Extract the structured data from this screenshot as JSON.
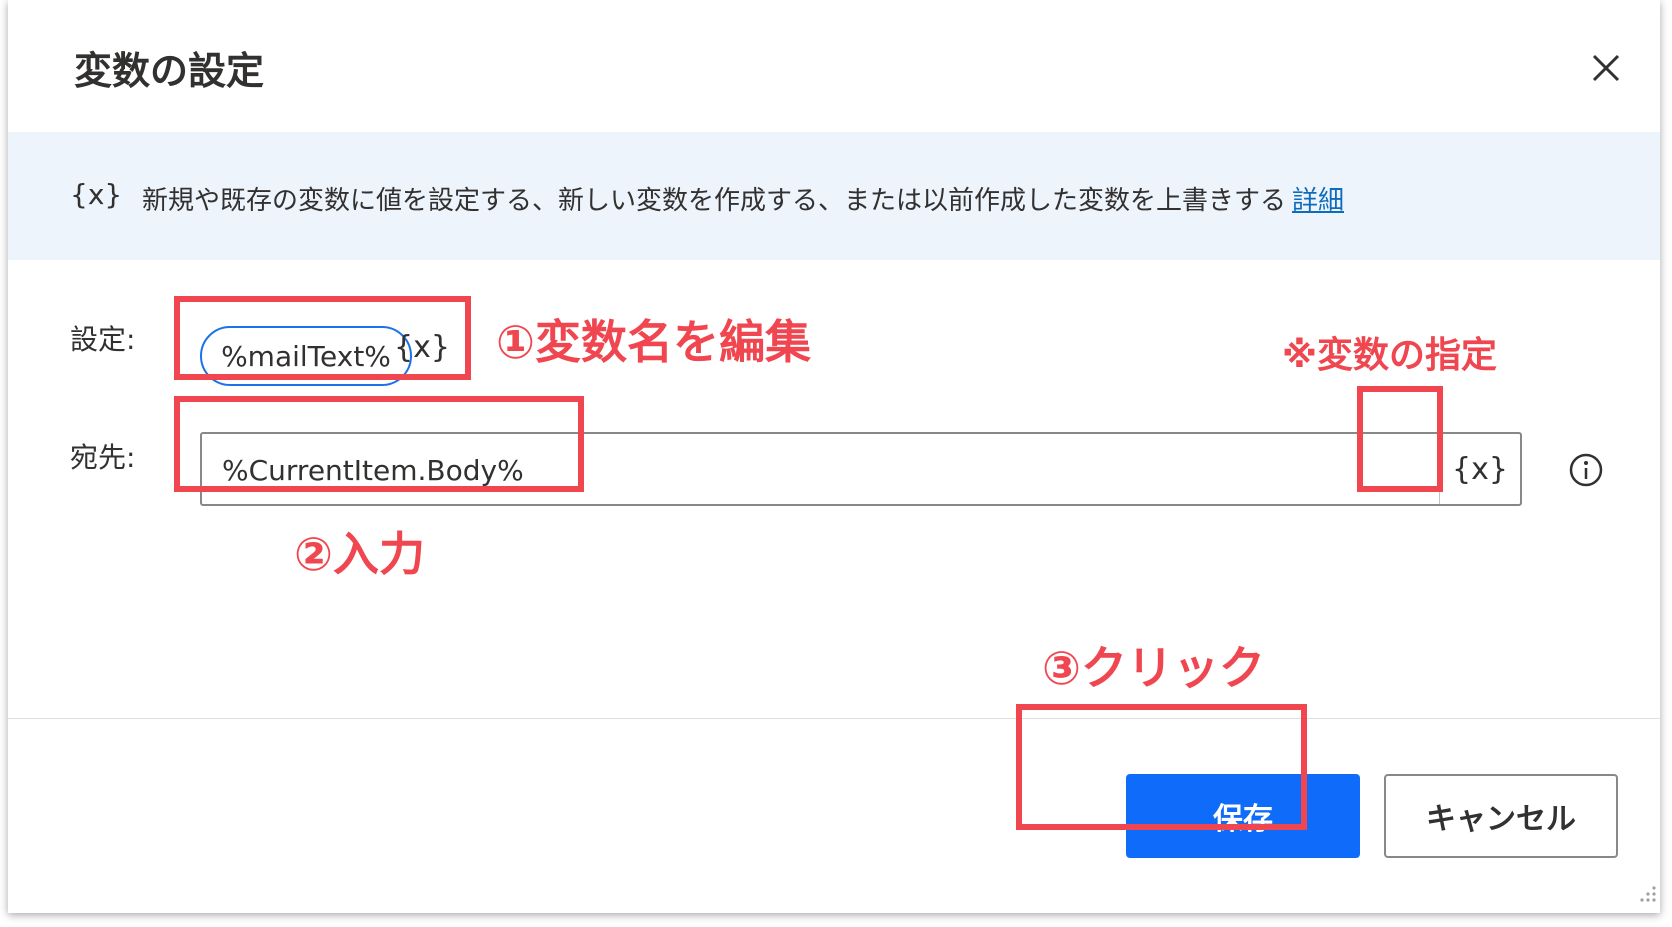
{
  "dialog": {
    "title": "変数の設定",
    "close_icon": "close-icon"
  },
  "banner": {
    "icon_text": "{x}",
    "description": "新規や既存の変数に値を設定する、新しい変数を作成する、または以前作成した変数を上書きする",
    "link_label": "詳細"
  },
  "form": {
    "set_label": "設定:",
    "set_value": "%mailText%",
    "set_var_icon": "{x}",
    "dest_label": "宛先:",
    "dest_value": "%CurrentItem.Body%",
    "dest_var_icon": "{x}",
    "info_icon": "info-icon"
  },
  "footer": {
    "save_label": "保存",
    "cancel_label": "キャンセル"
  },
  "annotations": {
    "step1": "①変数名を編集",
    "step2": "②入力",
    "step3": "③クリック",
    "note": "※変数の指定"
  },
  "colors": {
    "accent": "#0f6cfa",
    "annotation": "#f0464f",
    "banner_bg": "#eef4fc",
    "link": "#0f6cbd"
  }
}
